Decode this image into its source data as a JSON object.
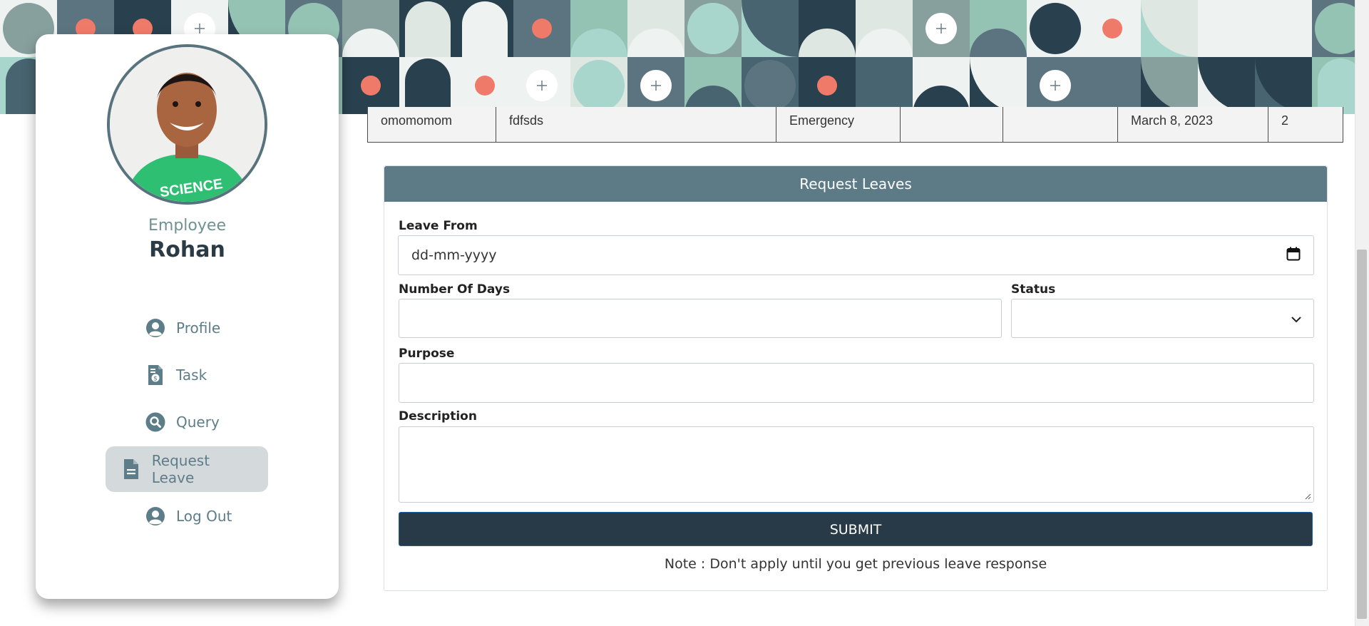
{
  "sidebar": {
    "role": "Employee",
    "name": "Rohan",
    "items": [
      {
        "label": "Profile",
        "icon": "user-circle-icon",
        "active": false
      },
      {
        "label": "Task",
        "icon": "invoice-icon",
        "active": false
      },
      {
        "label": "Query",
        "icon": "search-icon",
        "active": false
      },
      {
        "label": "Request Leave",
        "icon": "file-icon",
        "active": true
      },
      {
        "label": "Log Out",
        "icon": "user-circle-icon",
        "active": false
      }
    ]
  },
  "table": {
    "row": [
      "omomomom",
      "fdfsds",
      "Emergency",
      "",
      "",
      "March 8, 2023",
      "2"
    ]
  },
  "form": {
    "title": "Request Leaves",
    "leave_from_label": "Leave From",
    "leave_from_placeholder": "dd-mm-yyyy",
    "days_label": "Number Of Days",
    "status_label": "Status",
    "purpose_label": "Purpose",
    "description_label": "Description",
    "submit_label": "SUBMIT",
    "note": "Note : Don't apply until you get previous leave response"
  },
  "colors": {
    "accent": "#5d7a87",
    "dark": "#283947",
    "nav_text": "#5d7d89",
    "active_bg": "#d4d9dc",
    "banner_teal": "#a9d6cc",
    "banner_coral": "#f07a6a"
  }
}
